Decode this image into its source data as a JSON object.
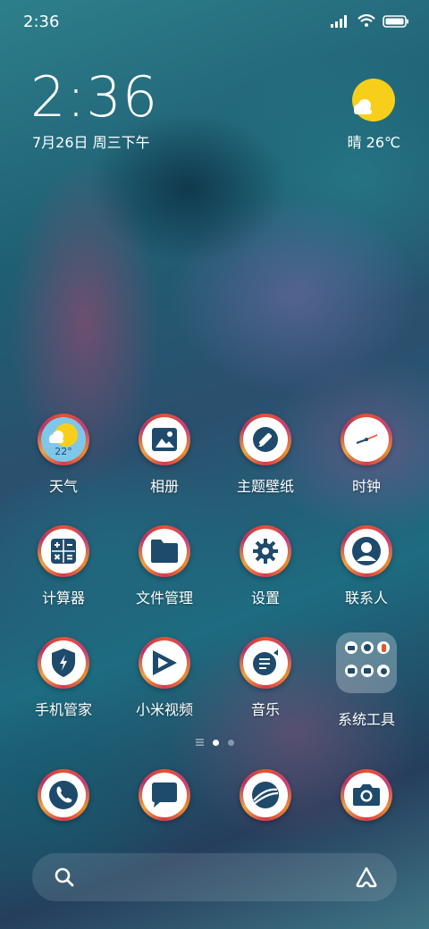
{
  "status_bar": {
    "time": "2:36"
  },
  "clock": {
    "time": "2:36",
    "date": "7月26日 周三下午"
  },
  "weather": {
    "condition": "晴",
    "temp": "26℃",
    "icon": "sun-cloud-icon"
  },
  "apps_row1": [
    {
      "label": "天气",
      "icon": "weather-icon",
      "badge": "22°"
    },
    {
      "label": "相册",
      "icon": "gallery-icon"
    },
    {
      "label": "主题壁纸",
      "icon": "themes-icon"
    },
    {
      "label": "时钟",
      "icon": "clock-icon"
    }
  ],
  "apps_row2": [
    {
      "label": "计算器",
      "icon": "calculator-icon"
    },
    {
      "label": "文件管理",
      "icon": "folder-icon"
    },
    {
      "label": "设置",
      "icon": "gear-icon"
    },
    {
      "label": "联系人",
      "icon": "contact-icon"
    }
  ],
  "apps_row3": [
    {
      "label": "手机管家",
      "icon": "shield-icon"
    },
    {
      "label": "小米视频",
      "icon": "video-play-icon"
    },
    {
      "label": "音乐",
      "icon": "music-icon"
    },
    {
      "label": "系统工具",
      "icon": "folder-group-icon"
    }
  ],
  "dock": [
    {
      "icon": "phone-icon"
    },
    {
      "icon": "message-icon"
    },
    {
      "icon": "browser-icon"
    },
    {
      "icon": "camera-icon"
    }
  ],
  "colors": {
    "icon_ring": "#e8532f",
    "icon_glyph": "#1e4a6b"
  }
}
